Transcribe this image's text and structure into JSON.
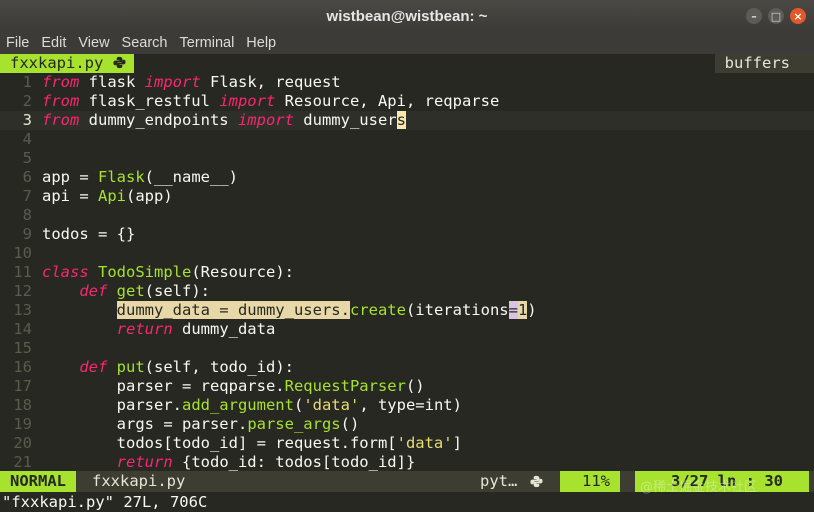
{
  "window": {
    "title": "wistbean@wistbean: ~",
    "buttons": {
      "minimize": "–",
      "maximize": "□",
      "close": "×"
    }
  },
  "menu": [
    "File",
    "Edit",
    "View",
    "Search",
    "Terminal",
    "Help"
  ],
  "tabline": {
    "tab": "fxxkapi.py",
    "tab_icon": "python-icon",
    "buffers": "buffers"
  },
  "code": {
    "lines": [
      {
        "n": "1",
        "tokens": [
          [
            "kw",
            "from"
          ],
          [
            "id",
            " flask "
          ],
          [
            "kw",
            "import"
          ],
          [
            "id",
            " Flask, request"
          ]
        ]
      },
      {
        "n": "2",
        "tokens": [
          [
            "kw",
            "from"
          ],
          [
            "id",
            " flask_restful "
          ],
          [
            "kw",
            "import"
          ],
          [
            "id",
            " Resource, Api, reqparse"
          ]
        ]
      },
      {
        "n": "3",
        "cur": true,
        "tokens": [
          [
            "kw",
            "from"
          ],
          [
            "id",
            " dummy_endpoints "
          ],
          [
            "kw",
            "import"
          ],
          [
            "id",
            " dummy_user"
          ],
          [
            "cursor",
            "s"
          ]
        ]
      },
      {
        "n": "4",
        "tokens": []
      },
      {
        "n": "5",
        "tokens": []
      },
      {
        "n": "6",
        "tokens": [
          [
            "id",
            "app = "
          ],
          [
            "fn",
            "Flask"
          ],
          [
            "id",
            "(__name__)"
          ]
        ]
      },
      {
        "n": "7",
        "tokens": [
          [
            "id",
            "api = "
          ],
          [
            "fn",
            "Api"
          ],
          [
            "id",
            "(app)"
          ]
        ]
      },
      {
        "n": "8",
        "tokens": []
      },
      {
        "n": "9",
        "tokens": [
          [
            "id",
            "todos = {}"
          ]
        ]
      },
      {
        "n": "10",
        "tokens": []
      },
      {
        "n": "11",
        "tokens": [
          [
            "kw",
            "class"
          ],
          [
            "id",
            " "
          ],
          [
            "cls",
            "TodoSimple"
          ],
          [
            "id",
            "(Resource):"
          ]
        ]
      },
      {
        "n": "12",
        "tokens": [
          [
            "id",
            "    "
          ],
          [
            "kw",
            "def"
          ],
          [
            "id",
            " "
          ],
          [
            "fn",
            "get"
          ],
          [
            "id",
            "(self):"
          ]
        ]
      },
      {
        "n": "13",
        "tokens": [
          [
            "id",
            "        "
          ],
          [
            "hl",
            "dummy_data = dummy_users."
          ],
          [
            "fn",
            "create"
          ],
          [
            "id",
            "(iterations"
          ],
          [
            "hl2",
            "="
          ],
          [
            "hl",
            "1"
          ],
          [
            "id",
            ")"
          ]
        ]
      },
      {
        "n": "14",
        "tokens": [
          [
            "id",
            "        "
          ],
          [
            "kw",
            "return"
          ],
          [
            "id",
            " dummy_data"
          ]
        ]
      },
      {
        "n": "15",
        "tokens": []
      },
      {
        "n": "16",
        "tokens": [
          [
            "id",
            "    "
          ],
          [
            "kw",
            "def"
          ],
          [
            "id",
            " "
          ],
          [
            "fn",
            "put"
          ],
          [
            "id",
            "(self, todo_id):"
          ]
        ]
      },
      {
        "n": "17",
        "tokens": [
          [
            "id",
            "        parser = reqparse."
          ],
          [
            "fn",
            "RequestParser"
          ],
          [
            "id",
            "()"
          ]
        ]
      },
      {
        "n": "18",
        "tokens": [
          [
            "id",
            "        parser."
          ],
          [
            "fn",
            "add_argument"
          ],
          [
            "id",
            "("
          ],
          [
            "str",
            "'data'"
          ],
          [
            "id",
            ", type=int)"
          ]
        ]
      },
      {
        "n": "19",
        "tokens": [
          [
            "id",
            "        args = parser."
          ],
          [
            "fn",
            "parse_args"
          ],
          [
            "id",
            "()"
          ]
        ]
      },
      {
        "n": "20",
        "tokens": [
          [
            "id",
            "        todos[todo_id] = request.form["
          ],
          [
            "str",
            "'data'"
          ],
          [
            "id",
            "]"
          ]
        ]
      },
      {
        "n": "21",
        "tokens": [
          [
            "id",
            "        "
          ],
          [
            "kw",
            "return"
          ],
          [
            "id",
            " {todo_id: todos[todo_id]}"
          ]
        ]
      }
    ]
  },
  "status": {
    "mode": "NORMAL",
    "file": "fxxkapi.py",
    "filetype": "pyt…",
    "filetype_icon": "python-icon",
    "percent": "11%",
    "position": "3/27 ln : 30"
  },
  "message": "\"fxxkapi.py\" 27L, 706C",
  "watermark": "@稀土掘金技术社区"
}
